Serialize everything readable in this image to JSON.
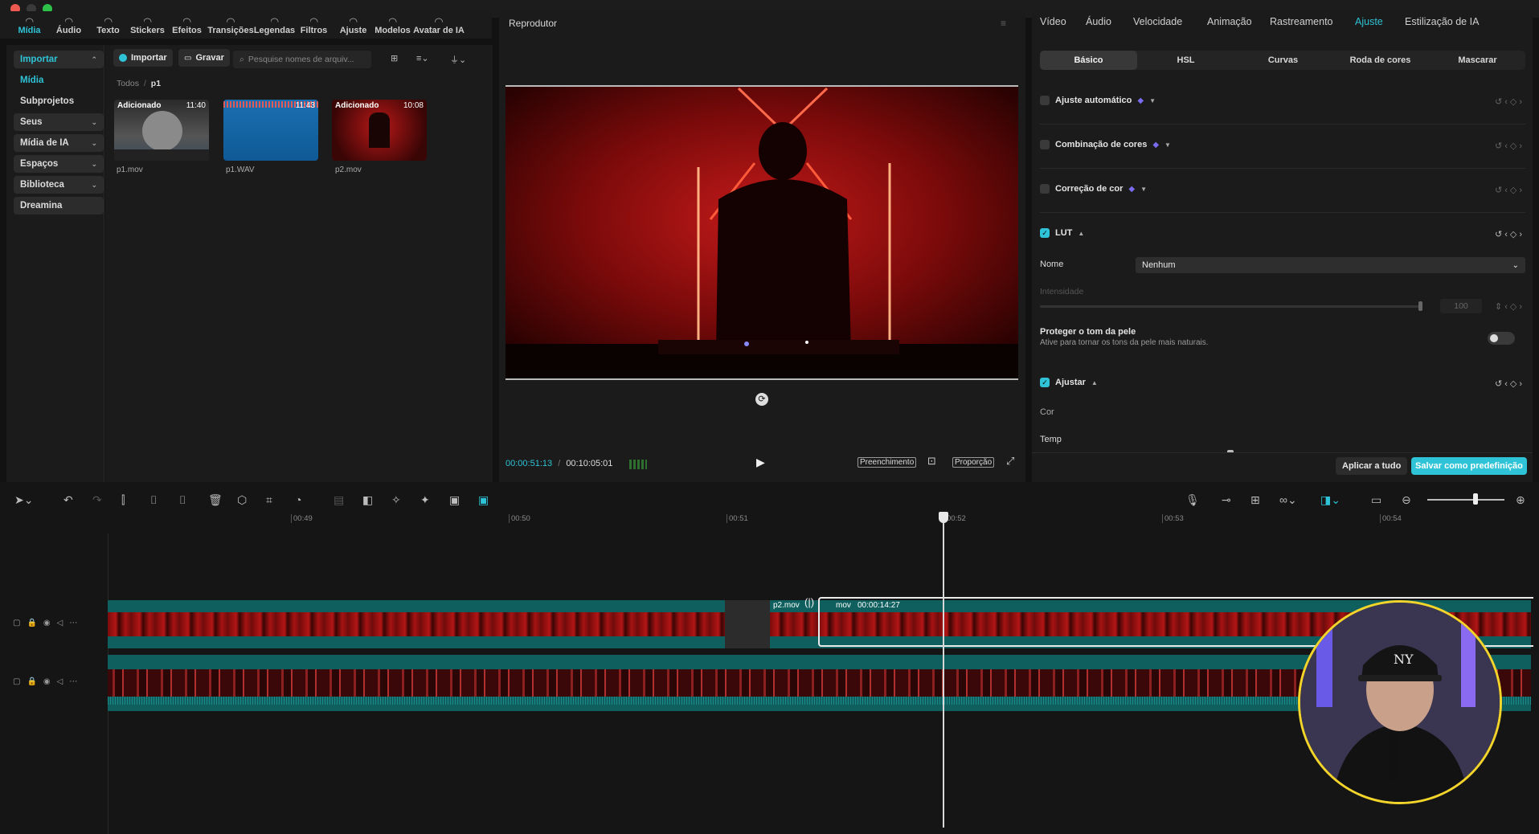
{
  "toolbar": {
    "tools": [
      {
        "label": "Mídia",
        "icon": "media-icon"
      },
      {
        "label": "Áudio",
        "icon": "audio-icon"
      },
      {
        "label": "Texto",
        "icon": "text-icon"
      },
      {
        "label": "Stickers",
        "icon": "sticker-icon"
      },
      {
        "label": "Efeitos",
        "icon": "effects-icon"
      },
      {
        "label": "Transições",
        "icon": "transitions-icon"
      },
      {
        "label": "Legendas",
        "icon": "captions-icon"
      },
      {
        "label": "Filtros",
        "icon": "filters-icon"
      },
      {
        "label": "Ajuste",
        "icon": "adjust-icon"
      },
      {
        "label": "Modelos",
        "icon": "templates-icon"
      },
      {
        "label": "Avatar de IA",
        "icon": "ai-avatar-icon"
      }
    ]
  },
  "leftnav": {
    "items": [
      {
        "label": "Importar",
        "style": "sel",
        "chev": "⌃"
      },
      {
        "label": "Mídia",
        "style": "plain-accent"
      },
      {
        "label": "Subprojetos",
        "style": "plain"
      },
      {
        "label": "Seus",
        "style": "box",
        "chev": "⌄"
      },
      {
        "label": "Mídia de IA",
        "style": "box",
        "chev": "⌄"
      },
      {
        "label": "Espaços",
        "style": "box",
        "chev": "⌄"
      },
      {
        "label": "Biblioteca",
        "style": "box",
        "chev": "⌄"
      },
      {
        "label": "Dreamina",
        "style": "box"
      }
    ]
  },
  "media": {
    "import_label": "Importar",
    "record_label": "Gravar",
    "search_placeholder": "Pesquise nomes de arquiv...",
    "breadcrumb_root": "Todos",
    "breadcrumb_sep": "/",
    "breadcrumb_current": "p1",
    "items": [
      {
        "badge": "Adicionado",
        "duration": "11:40",
        "name": "p1.mov"
      },
      {
        "badge": "",
        "duration": "11:43",
        "name": "p1.WAV"
      },
      {
        "badge": "Adicionado",
        "duration": "10:08",
        "name": "p2.mov"
      }
    ]
  },
  "player": {
    "title": "Reprodutor",
    "current_time": "00:00:51:13",
    "total_time": "00:10:05:01",
    "fill_label": "Preenchimento",
    "ratio_label": "Proporção"
  },
  "right": {
    "tabs": [
      "Vídeo",
      "Áudio",
      "Velocidade",
      "Animação",
      "Rastreamento",
      "Ajuste",
      "Estilização de IA"
    ],
    "active_tab": "Ajuste",
    "subtabs": [
      "Básico",
      "HSL",
      "Curvas",
      "Roda de cores",
      "Mascarar"
    ],
    "active_subtab": "Básico",
    "sections": {
      "auto": "Ajuste automático",
      "combo": "Combinação de cores",
      "correction": "Correção de cor",
      "lut": "LUT",
      "name_label": "Nome",
      "name_value": "Nenhum",
      "intensity_label": "Intensidade",
      "intensity_value": "100",
      "skin_title": "Proteger o tom da pele",
      "skin_desc": "Ative para tornar os tons da pele mais naturais.",
      "adjust": "Ajustar",
      "color_label": "Cor",
      "temp_label": "Temp"
    },
    "apply_all": "Aplicar a tudo",
    "save_preset": "Salvar como predefinição"
  },
  "timeline": {
    "ticks": [
      "00:49",
      "00:50",
      "00:51",
      "00:52",
      "00:53",
      "00:54"
    ],
    "clip_label_a": "p2.mov",
    "clip_label_b": "mov",
    "clip_duration": "00:00:14:27"
  },
  "colors": {
    "accent": "#2ec3d6",
    "pip_border": "#f3d42a"
  }
}
